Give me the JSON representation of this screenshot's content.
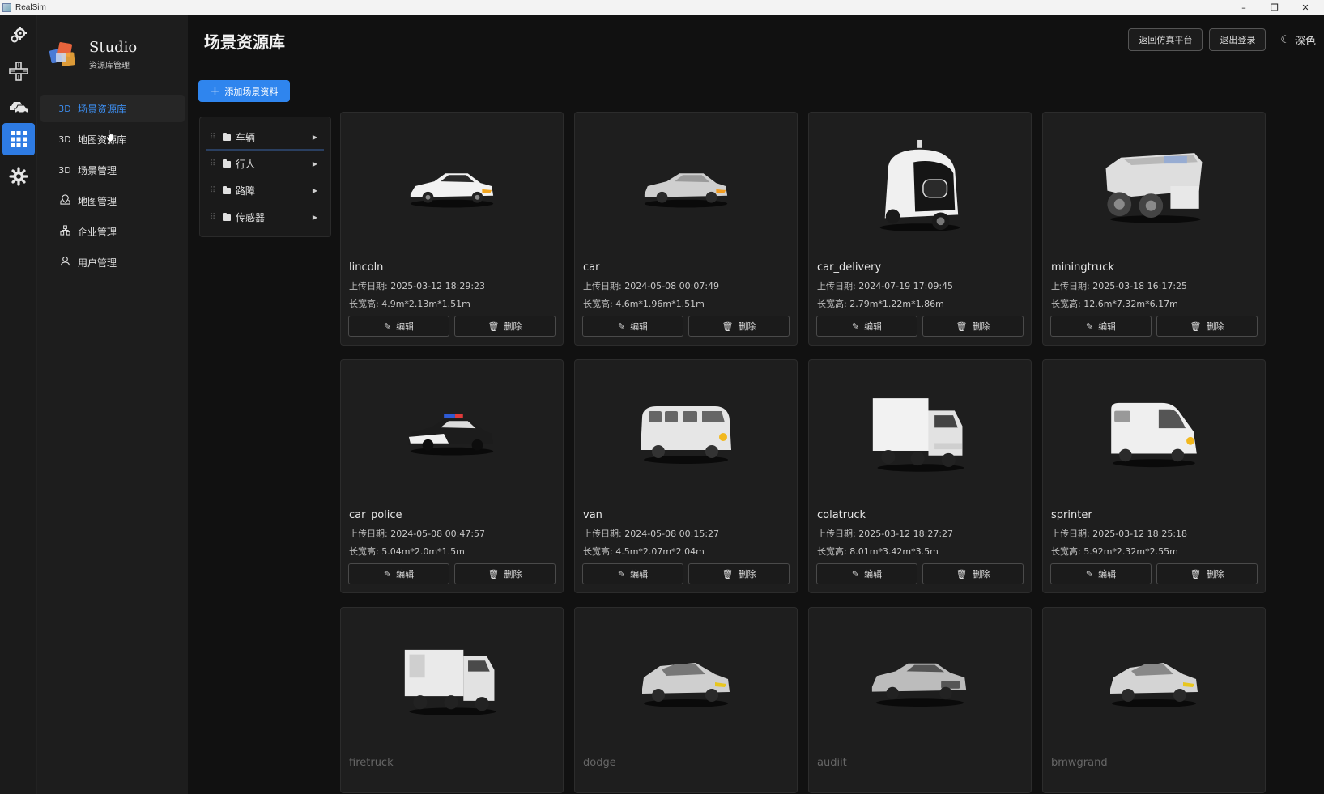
{
  "window": {
    "title": "RealSim",
    "controls": [
      "–",
      "❐",
      "✕"
    ]
  },
  "brand": {
    "name": "Studio",
    "subtitle": "资源库管理"
  },
  "rail": {
    "items": [
      {
        "icon": "gears-icon"
      },
      {
        "icon": "crossroad-icon"
      },
      {
        "icon": "cars-icon"
      },
      {
        "icon": "grid-apps-icon",
        "active": true
      },
      {
        "icon": "settings-gear-icon"
      }
    ]
  },
  "sidebar": {
    "items": [
      {
        "icon": "3D",
        "label": "场景资源库",
        "active": true
      },
      {
        "icon": "3D",
        "label": "地图资源库"
      },
      {
        "icon": "3D",
        "label": "场景管理"
      },
      {
        "icon": "map-icon",
        "label": "地图管理"
      },
      {
        "icon": "org-icon",
        "label": "企业管理"
      },
      {
        "icon": "user-icon",
        "label": "用户管理"
      }
    ]
  },
  "header": {
    "title": "场景资源库",
    "back_button": "返回仿真平台",
    "logout_button": "退出登录",
    "theme_label": "深色"
  },
  "toolbar": {
    "add_label": "添加场景资料"
  },
  "tree": {
    "items": [
      {
        "label": "车辆",
        "active": true
      },
      {
        "label": "行人"
      },
      {
        "label": "路障"
      },
      {
        "label": "传感器"
      }
    ]
  },
  "card_labels": {
    "upload_key": "上传日期:",
    "size_key": "长宽高:",
    "edit": "编辑",
    "delete": "删除"
  },
  "cards": [
    {
      "name": "lincoln",
      "date": "2025-03-12 18:29:23",
      "size": "4.9m*2.13m*1.51m",
      "model": "sedan-white"
    },
    {
      "name": "car",
      "date": "2024-05-08 00:07:49",
      "size": "4.6m*1.96m*1.51m",
      "model": "sedan-grey"
    },
    {
      "name": "car_delivery",
      "date": "2024-07-19 17:09:45",
      "size": "2.79m*1.22m*1.86m",
      "model": "delivery-pod"
    },
    {
      "name": "miningtruck",
      "date": "2025-03-18 16:17:25",
      "size": "12.6m*7.32m*6.17m",
      "model": "mining-truck"
    },
    {
      "name": "car_police",
      "date": "2024-05-08 00:47:57",
      "size": "5.04m*2.0m*1.5m",
      "model": "police-car"
    },
    {
      "name": "van",
      "date": "2024-05-08 00:15:27",
      "size": "4.5m*2.07m*2.04m",
      "model": "vw-van"
    },
    {
      "name": "colatruck",
      "date": "2025-03-12 18:27:27",
      "size": "8.01m*3.42m*3.5m",
      "model": "box-truck"
    },
    {
      "name": "sprinter",
      "date": "2025-03-12 18:25:18",
      "size": "5.92m*2.32m*2.55m",
      "model": "sprinter-van"
    },
    {
      "name": "firetruck",
      "model": "fire-truck"
    },
    {
      "name": "dodge",
      "model": "hatch-grey"
    },
    {
      "name": "audiit",
      "model": "audi-grey"
    },
    {
      "name": "bmwgrand",
      "model": "bmw-grey"
    }
  ],
  "colors": {
    "accent": "#2f85ee",
    "background": "#111111",
    "sidebar": "#1d1d1d",
    "card": "#1e1e1e"
  }
}
